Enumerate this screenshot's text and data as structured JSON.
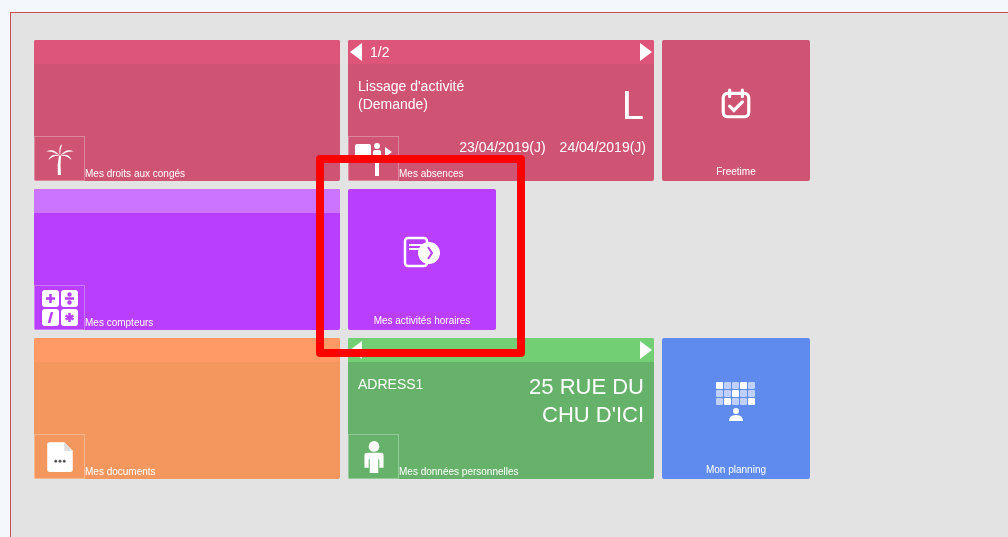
{
  "rows": [
    [
      {
        "kind": "wide",
        "label": "Mes droits aux congés"
      },
      {
        "kind": "wide",
        "label": "Mes absences",
        "paged": true,
        "page": "1/2",
        "content": {
          "kind": "absence",
          "title": "Lissage d'activité",
          "subtitle": "(Demande)",
          "code": "L",
          "dates": [
            "23/04/2019(J)",
            "24/04/2019(J)"
          ]
        }
      },
      {
        "kind": "small",
        "label": "Freetime"
      }
    ],
    [
      {
        "kind": "wide",
        "label": "Mes compteurs"
      },
      {
        "kind": "small",
        "label": "Mes activités horaires"
      }
    ],
    [
      {
        "kind": "wide",
        "label": "Mes documents"
      },
      {
        "kind": "wide",
        "label": "Mes données personnelles",
        "paged": true,
        "content": {
          "kind": "address",
          "title": "ADRESS1",
          "lines": [
            "25 RUE DU",
            "CHU D'ICI"
          ]
        }
      },
      {
        "kind": "small",
        "label": "Mon planning"
      }
    ]
  ]
}
